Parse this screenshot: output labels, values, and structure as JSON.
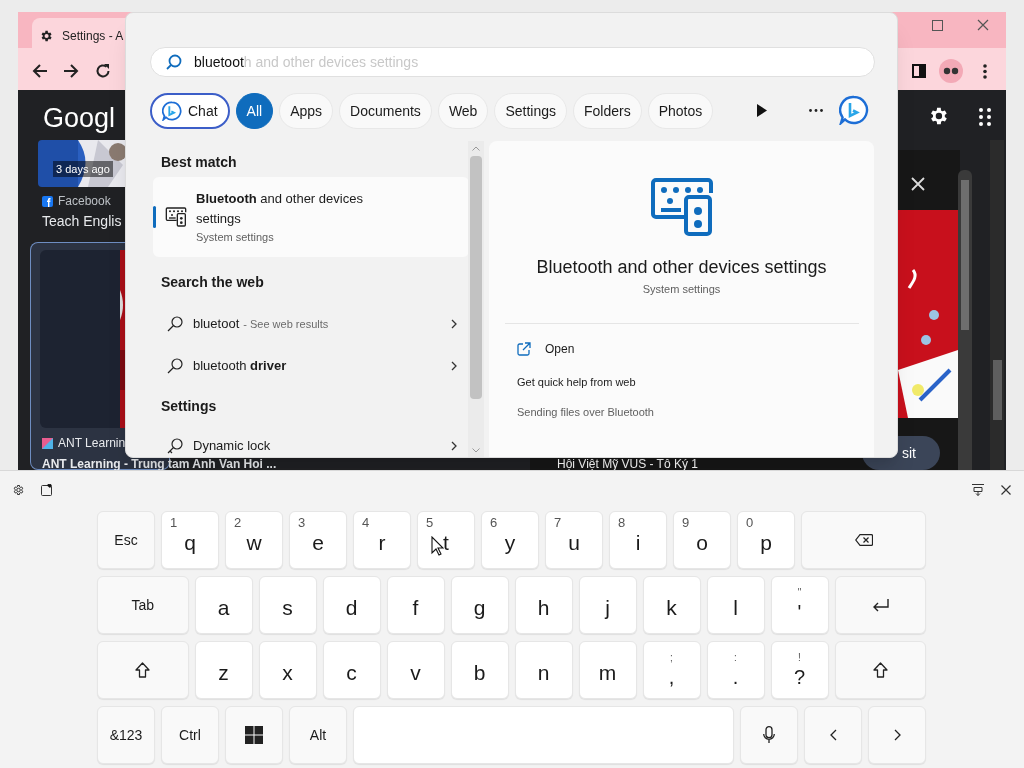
{
  "browser": {
    "tab_title": "Settings - A",
    "logo": "Googl",
    "cards": [
      {
        "badge": "3 days ago",
        "source": "Facebook",
        "title": "Teach Englis"
      },
      {
        "source": "ANT Learnin",
        "title": "ANT Learning - Trung tam Anh Van Hoi ..."
      }
    ],
    "right_card": {
      "title": "Hội Việt Mỹ VUS - Tô Ký 1",
      "button": "sit"
    }
  },
  "search": {
    "query": "bluetoot",
    "completion": "h and other devices settings",
    "filters": [
      {
        "label": "Chat",
        "kind": "chat",
        "selected": false
      },
      {
        "label": "All",
        "kind": "plain",
        "selected": true
      },
      {
        "label": "Apps",
        "kind": "plain",
        "selected": false
      },
      {
        "label": "Documents",
        "kind": "plain",
        "selected": false
      },
      {
        "label": "Web",
        "kind": "plain",
        "selected": false
      },
      {
        "label": "Settings",
        "kind": "plain",
        "selected": false
      },
      {
        "label": "Folders",
        "kind": "plain",
        "selected": false
      },
      {
        "label": "Photos",
        "kind": "plain",
        "selected": false
      }
    ],
    "best_match": {
      "heading": "Best match",
      "title": "**Bluetooth** and other devices settings",
      "subtitle": "System settings",
      "selected": true
    },
    "web": {
      "heading": "Search the web",
      "items": [
        {
          "text": "bluetoot",
          "note": "- See web results"
        },
        {
          "text": "bluetooth **driver**"
        }
      ]
    },
    "settings": {
      "heading": "Settings",
      "items": [
        {
          "text": "Dynamic lock"
        }
      ]
    },
    "detail": {
      "title": "Bluetooth and other devices settings",
      "subtitle": "System settings",
      "actions": [
        {
          "label": "Open"
        }
      ],
      "help_heading": "Get quick help from web",
      "links": [
        "Sending files over Bluetooth"
      ]
    }
  },
  "keyboard": {
    "rows": [
      [
        {
          "kind": "text",
          "label": "Esc"
        },
        {
          "kind": "letter",
          "label": "q",
          "hint": "1"
        },
        {
          "kind": "letter",
          "label": "w",
          "hint": "2"
        },
        {
          "kind": "letter",
          "label": "e",
          "hint": "3"
        },
        {
          "kind": "letter",
          "label": "r",
          "hint": "4"
        },
        {
          "kind": "letter",
          "label": "t",
          "hint": "5"
        },
        {
          "kind": "letter",
          "label": "y",
          "hint": "6"
        },
        {
          "kind": "letter",
          "label": "u",
          "hint": "7"
        },
        {
          "kind": "letter",
          "label": "i",
          "hint": "8"
        },
        {
          "kind": "letter",
          "label": "o",
          "hint": "9"
        },
        {
          "kind": "letter",
          "label": "p",
          "hint": "0"
        },
        {
          "kind": "backspace"
        }
      ],
      [
        {
          "kind": "wide-text",
          "label": "Tab"
        },
        {
          "kind": "letter",
          "label": "a"
        },
        {
          "kind": "letter",
          "label": "s"
        },
        {
          "kind": "letter",
          "label": "d"
        },
        {
          "kind": "letter",
          "label": "f"
        },
        {
          "kind": "letter",
          "label": "g"
        },
        {
          "kind": "letter",
          "label": "h"
        },
        {
          "kind": "letter",
          "label": "j"
        },
        {
          "kind": "letter",
          "label": "k"
        },
        {
          "kind": "letter",
          "label": "l"
        },
        {
          "kind": "punct",
          "label": "'",
          "hint": "\""
        },
        {
          "kind": "enter"
        }
      ],
      [
        {
          "kind": "shift"
        },
        {
          "kind": "letter",
          "label": "z"
        },
        {
          "kind": "letter",
          "label": "x"
        },
        {
          "kind": "letter",
          "label": "c"
        },
        {
          "kind": "letter",
          "label": "v"
        },
        {
          "kind": "letter",
          "label": "b"
        },
        {
          "kind": "letter",
          "label": "n"
        },
        {
          "kind": "letter",
          "label": "m"
        },
        {
          "kind": "punct",
          "label": ",",
          "hint": ";"
        },
        {
          "kind": "punct",
          "label": ".",
          "hint": ":"
        },
        {
          "kind": "punct",
          "label": "?",
          "hint": "!"
        },
        {
          "kind": "shift"
        }
      ],
      [
        {
          "kind": "text",
          "label": "&123"
        },
        {
          "kind": "text",
          "label": "Ctrl"
        },
        {
          "kind": "windows"
        },
        {
          "kind": "text",
          "label": "Alt"
        },
        {
          "kind": "space"
        },
        {
          "kind": "mic"
        },
        {
          "kind": "left"
        },
        {
          "kind": "right"
        }
      ]
    ]
  }
}
